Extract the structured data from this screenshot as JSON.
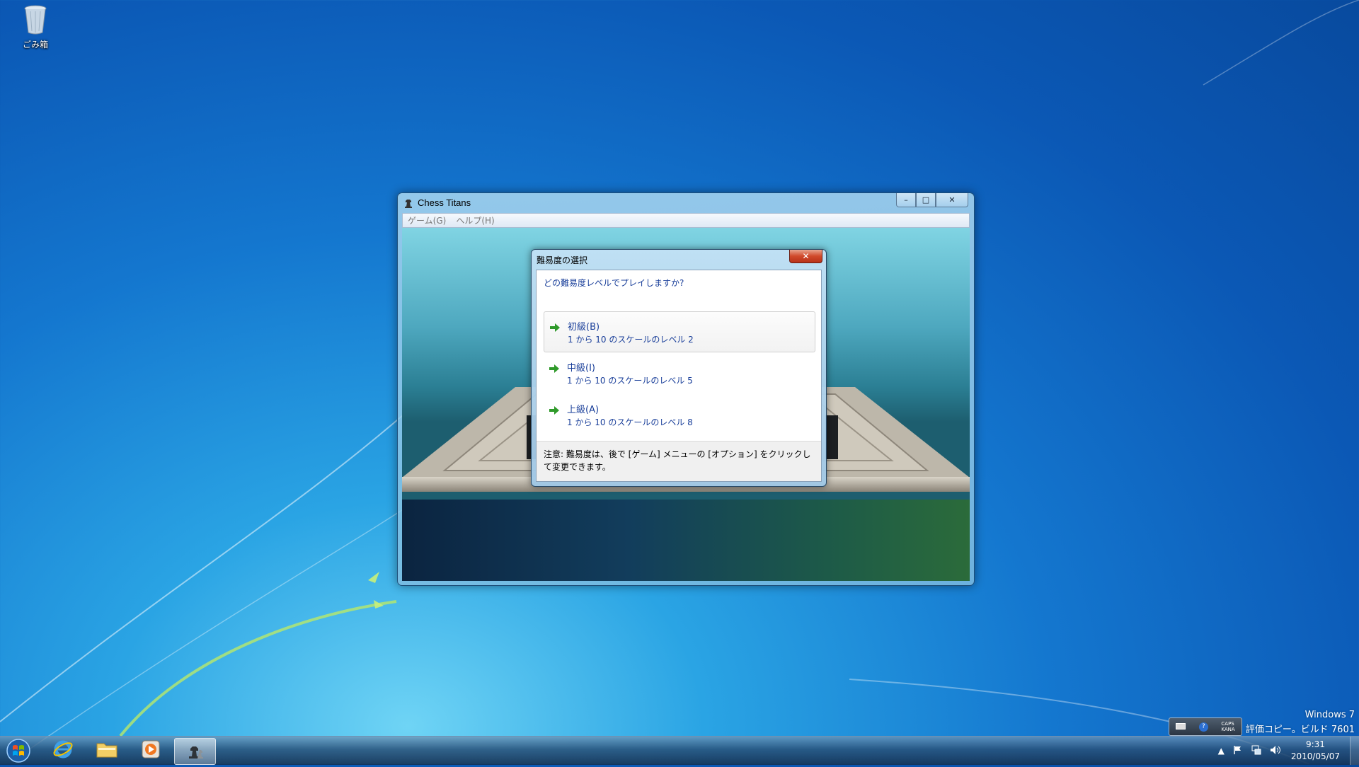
{
  "desktop": {
    "recycle_bin_label": "ごみ箱",
    "watermark_line1": "Windows 7",
    "watermark_line2": "評価コピー。ビルド 7601"
  },
  "window": {
    "title": "Chess Titans",
    "menu": [
      "ゲーム(G)",
      "ヘルプ(H)"
    ],
    "minimize": "–",
    "maximize": "□",
    "close": "✕"
  },
  "dialog": {
    "title": "難易度の選択",
    "close": "✕",
    "question": "どの難易度レベルでプレイしますか?",
    "options": [
      {
        "label": "初級(B)",
        "desc": "1 から 10 のスケールのレベル 2"
      },
      {
        "label": "中級(I)",
        "desc": "1 から 10 のスケールのレベル 5"
      },
      {
        "label": "上級(A)",
        "desc": "1 から 10 のスケールのレベル 8"
      }
    ],
    "note": "注意: 難易度は、後で [ゲーム] メニューの [オプション] をクリックして変更できます。"
  },
  "langbar": {
    "caps": "CAPS",
    "kana": "KANA"
  },
  "tray": {
    "time": "9:31",
    "date": "2010/05/07"
  }
}
